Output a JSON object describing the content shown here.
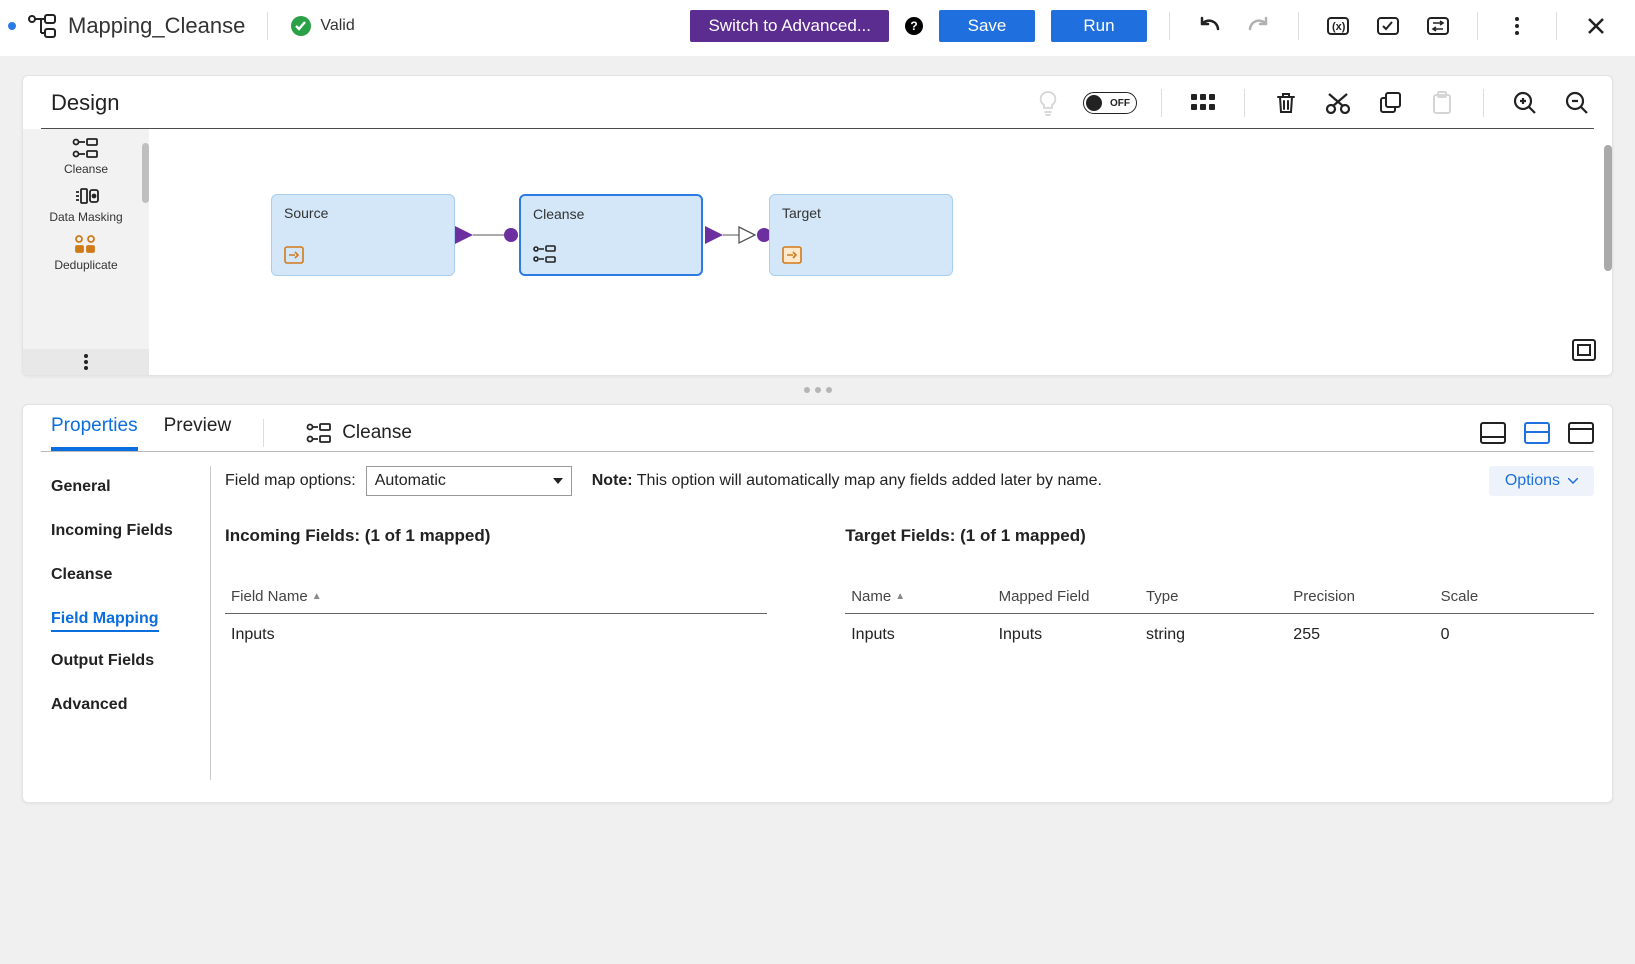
{
  "topbar": {
    "title": "Mapping_Cleanse",
    "status": "Valid",
    "switch_btn": "Switch to Advanced...",
    "save_btn": "Save",
    "run_btn": "Run"
  },
  "design": {
    "title": "Design",
    "toggle_label": "OFF",
    "palette": [
      {
        "label": "Cleanse"
      },
      {
        "label": "Data Masking"
      },
      {
        "label": "Deduplicate"
      }
    ],
    "nodes": {
      "source": "Source",
      "cleanse": "Cleanse",
      "target": "Target"
    }
  },
  "properties": {
    "tabs": {
      "properties": "Properties",
      "preview": "Preview"
    },
    "object_name": "Cleanse",
    "side_nav": {
      "general": "General",
      "incoming": "Incoming Fields",
      "cleanse": "Cleanse",
      "field_mapping": "Field Mapping",
      "output_fields": "Output Fields",
      "advanced": "Advanced"
    },
    "fm_label": "Field map options:",
    "fm_select_value": "Automatic",
    "fm_note_bold": "Note:",
    "fm_note_rest": " This option will automatically map any fields added later by name.",
    "fm_options_btn": "Options",
    "incoming_title": "Incoming Fields: (1 of 1 mapped)",
    "target_title": "Target Fields: (1 of 1 mapped)",
    "incoming_hdr_fieldname": "Field Name",
    "incoming_rows": [
      {
        "field": "Inputs"
      }
    ],
    "target_hdr": {
      "name": "Name",
      "mapped": "Mapped Field",
      "type": "Type",
      "prec": "Precision",
      "scale": "Scale"
    },
    "target_rows": [
      {
        "name": "Inputs",
        "mapped": "Inputs",
        "type": "string",
        "prec": "255",
        "scale": "0"
      }
    ]
  }
}
